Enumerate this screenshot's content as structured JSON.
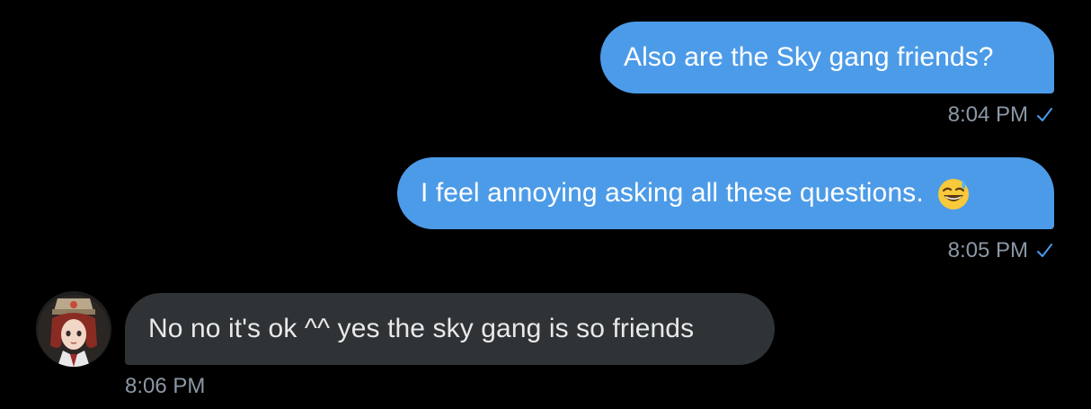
{
  "conversation": {
    "messages": [
      {
        "direction": "sent",
        "text": "Also are the Sky gang friends?",
        "time": "8:04 PM",
        "read_icon": "checkmark-icon"
      },
      {
        "direction": "sent",
        "text": "I feel annoying asking all these questions.",
        "emoji": "grinning-sweat-emoji",
        "time": "8:05 PM",
        "read_icon": "checkmark-icon"
      },
      {
        "direction": "received",
        "text": "No no it's ok ^^ yes the sky gang is so friends",
        "time": "8:06 PM",
        "avatar_icon": "user-avatar"
      }
    ]
  },
  "colors": {
    "background": "#000000",
    "sent_bubble": "#4c9be8",
    "received_bubble": "#2f3336",
    "timestamp": "#8b98a5"
  }
}
